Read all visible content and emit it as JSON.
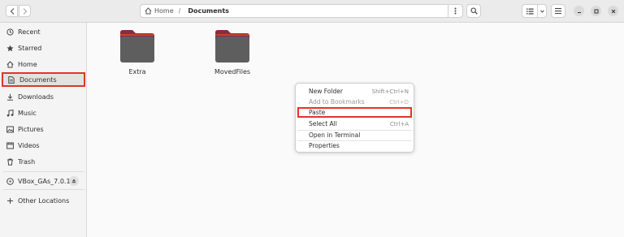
{
  "header": {
    "breadcrumbs": [
      {
        "label": "Home",
        "icon": "home-icon"
      },
      {
        "label": "Documents"
      }
    ],
    "separator": "/"
  },
  "sidebar": {
    "items": [
      {
        "label": "Recent",
        "icon": "clock-icon"
      },
      {
        "label": "Starred",
        "icon": "star-icon"
      },
      {
        "label": "Home",
        "icon": "home-icon"
      },
      {
        "label": "Documents",
        "icon": "document-icon",
        "selected": true
      },
      {
        "label": "Downloads",
        "icon": "download-icon"
      },
      {
        "label": "Music",
        "icon": "music-note-icon"
      },
      {
        "label": "Pictures",
        "icon": "picture-icon"
      },
      {
        "label": "Videos",
        "icon": "video-icon"
      },
      {
        "label": "Trash",
        "icon": "trash-icon"
      }
    ],
    "device": {
      "label": "VBox_GAs_7.0.10",
      "icon": "disc-icon"
    },
    "other": {
      "label": "Other Locations",
      "icon": "plus-icon"
    }
  },
  "content": {
    "folders": [
      {
        "name": "Extra"
      },
      {
        "name": "MovedFiles"
      }
    ]
  },
  "context_menu": {
    "items": [
      {
        "label": "New Folder",
        "shortcut": "Shift+Ctrl+N",
        "enabled": true
      },
      {
        "label": "Add to Bookmarks",
        "shortcut": "Ctrl+D",
        "enabled": false
      },
      {
        "label": "Paste",
        "shortcut": "",
        "enabled": true,
        "highlighted": true
      },
      {
        "label": "Select All",
        "shortcut": "Ctrl+A",
        "enabled": true
      },
      {
        "label": "Open in Terminal",
        "shortcut": "",
        "enabled": true
      },
      {
        "label": "Properties",
        "shortcut": "",
        "enabled": true
      }
    ]
  },
  "colors": {
    "highlight_border": "#e0352b",
    "folder_body": "#5e5e5e",
    "folder_tab": "#8b2a44",
    "folder_accent": "#e95420"
  }
}
